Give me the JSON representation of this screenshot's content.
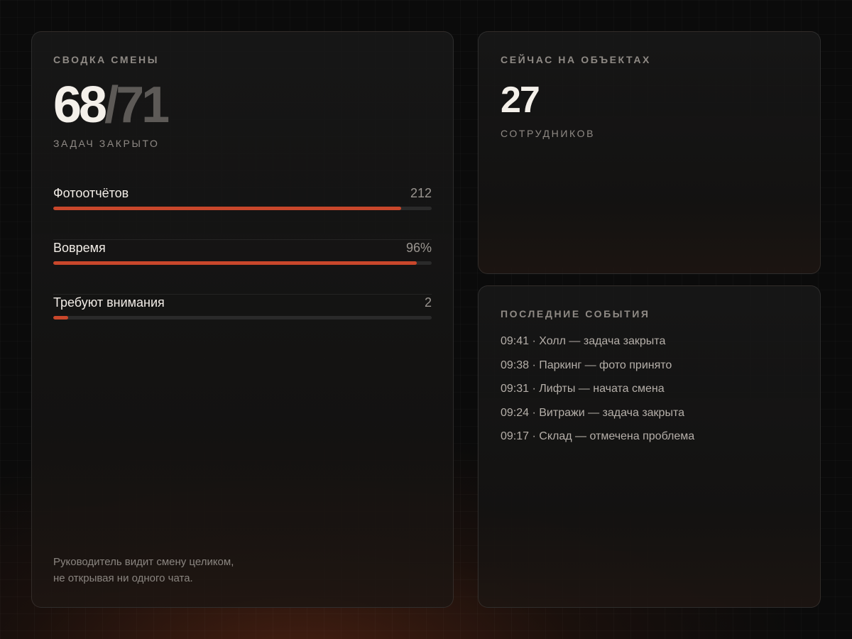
{
  "summary": {
    "title": "СВОДКА СМЕНЫ",
    "tasks_done": "68",
    "separator": "/",
    "tasks_total": "71",
    "caption": "ЗАДАЧ ЗАКРЫТО",
    "metrics": [
      {
        "label": "Фотоотчётов",
        "value": "212",
        "fill_fraction": 0.92
      },
      {
        "label": "Вовремя",
        "value": "96%",
        "fill_fraction": 0.96
      },
      {
        "label": "Требуют внимания",
        "value": "2",
        "fill_fraction": 0.04
      }
    ],
    "footnote_line1": "Руководитель видит смену целиком,",
    "footnote_line2": "не открывая ни одного чата."
  },
  "onsite": {
    "title": "СЕЙЧАС НА ОБЪЕКТАХ",
    "count": "27",
    "caption": "СОТРУДНИКОВ"
  },
  "events": {
    "title": "ПОСЛЕДНИЕ СОБЫТИЯ",
    "items": [
      "09:41 · Холл — задача закрыта",
      "09:38 · Паркинг — фото принято",
      "09:31 · Лифты — начата смена",
      "09:24 · Витражи — задача закрыта",
      "09:17 · Склад — отмечена проблема"
    ]
  },
  "colors": {
    "accent": "#c9472b",
    "background": "#0b0b0b",
    "card": "#161616",
    "text_primary": "#f2ede7",
    "text_muted": "#8f8a85"
  }
}
